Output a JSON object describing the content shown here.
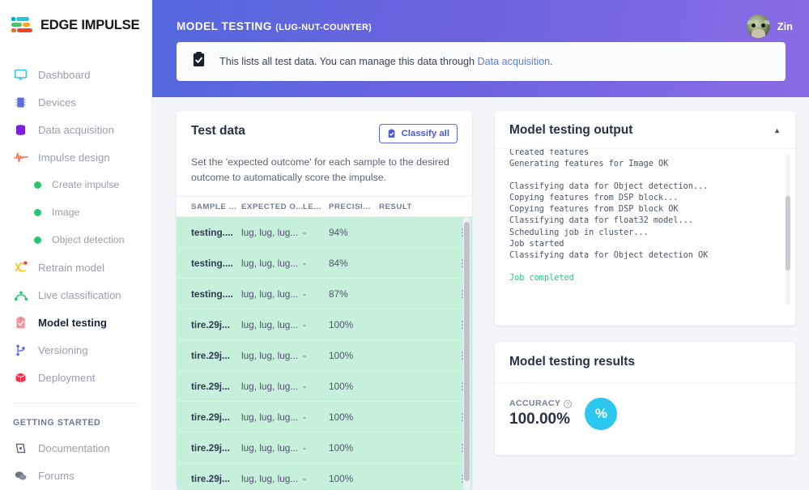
{
  "brand": {
    "name": "EDGE IMPULSE",
    "logo_icon": "edge-impulse-logo-icon"
  },
  "sidebar": {
    "items": [
      {
        "label": "Dashboard",
        "icon": "monitor-icon"
      },
      {
        "label": "Devices",
        "icon": "chip-icon"
      },
      {
        "label": "Data acquisition",
        "icon": "database-icon"
      },
      {
        "label": "Impulse design",
        "icon": "pulse-icon"
      }
    ],
    "sub_items": [
      {
        "label": "Create impulse",
        "icon": "dot-icon"
      },
      {
        "label": "Image",
        "icon": "dot-icon"
      },
      {
        "label": "Object detection",
        "icon": "dot-icon"
      }
    ],
    "items2": [
      {
        "label": "Retrain model",
        "icon": "shuffle-icon",
        "active": false
      },
      {
        "label": "Live classification",
        "icon": "graph-icon",
        "active": false
      },
      {
        "label": "Model testing",
        "icon": "clipboard-check-icon",
        "active": true
      },
      {
        "label": "Versioning",
        "icon": "branch-icon",
        "active": false
      },
      {
        "label": "Deployment",
        "icon": "box-icon",
        "active": false
      }
    ],
    "section_title": "GETTING STARTED",
    "items3": [
      {
        "label": "Documentation",
        "icon": "book-icon"
      },
      {
        "label": "Forums",
        "icon": "chat-icon"
      }
    ]
  },
  "topbar": {
    "title": "MODEL TESTING",
    "project": "(LUG-NUT-COUNTER)",
    "username": "Zin",
    "avatar_icon": "user-avatar"
  },
  "banner": {
    "icon": "clipboard-check-icon",
    "text_before": "This lists all test data. You can manage this data through ",
    "link": "Data acquisition",
    "text_after": "."
  },
  "test_data": {
    "title": "Test data",
    "classify_all_label": "Classify all",
    "classify_icon": "clipboard-check-icon",
    "description": "Set the 'expected outcome' for each sample to the desired outcome to automatically score the impulse.",
    "columns": [
      "SAMPLE ...",
      "EXPECTED O...",
      "LE...",
      "PRECISI...",
      "RESULT"
    ],
    "rows": [
      {
        "sample": "testing....",
        "expected": "lug, lug, lug...",
        "length": "-",
        "precision": "94%",
        "result": "",
        "menu": "kebab-menu-icon"
      },
      {
        "sample": "testing....",
        "expected": "lug, lug, lug...",
        "length": "-",
        "precision": "84%",
        "result": "",
        "menu": "kebab-menu-icon"
      },
      {
        "sample": "testing....",
        "expected": "lug, lug, lug...",
        "length": "-",
        "precision": "87%",
        "result": "",
        "menu": "kebab-menu-icon"
      },
      {
        "sample": "tire.29j...",
        "expected": "lug, lug, lug...",
        "length": "-",
        "precision": "100%",
        "result": "",
        "menu": "kebab-menu-icon"
      },
      {
        "sample": "tire.29j...",
        "expected": "lug, lug, lug...",
        "length": "-",
        "precision": "100%",
        "result": "",
        "menu": "kebab-menu-icon"
      },
      {
        "sample": "tire.29j...",
        "expected": "lug, lug, lug...",
        "length": "-",
        "precision": "100%",
        "result": "",
        "menu": "kebab-menu-icon"
      },
      {
        "sample": "tire.29j...",
        "expected": "lug, lug, lug...",
        "length": "-",
        "precision": "100%",
        "result": "",
        "menu": "kebab-menu-icon"
      },
      {
        "sample": "tire.29j...",
        "expected": "lug, lug, lug...",
        "length": "-",
        "precision": "100%",
        "result": "",
        "menu": "kebab-menu-icon"
      },
      {
        "sample": "tire.29j...",
        "expected": "lug, lug, lug...",
        "length": "-",
        "precision": "100%",
        "result": "",
        "menu": "kebab-menu-icon"
      }
    ]
  },
  "output": {
    "title": "Model testing output",
    "collapse_icon": "chevron-up-icon",
    "log_top": "Created features\nGenerating features for Image OK\n\nClassifying data for Object detection...\nCopying features from DSP block...\nCopying features from DSP block OK\nClassifying data for float32 model...\nScheduling job in cluster...\nJob started\nClassifying data for Object detection OK\n",
    "log_success": "\nJob completed"
  },
  "results": {
    "title": "Model testing results",
    "accuracy_label": "ACCURACY",
    "accuracy_value": "100.00%",
    "badge_glyph": "%",
    "badge_color": "#2bc7ef"
  }
}
